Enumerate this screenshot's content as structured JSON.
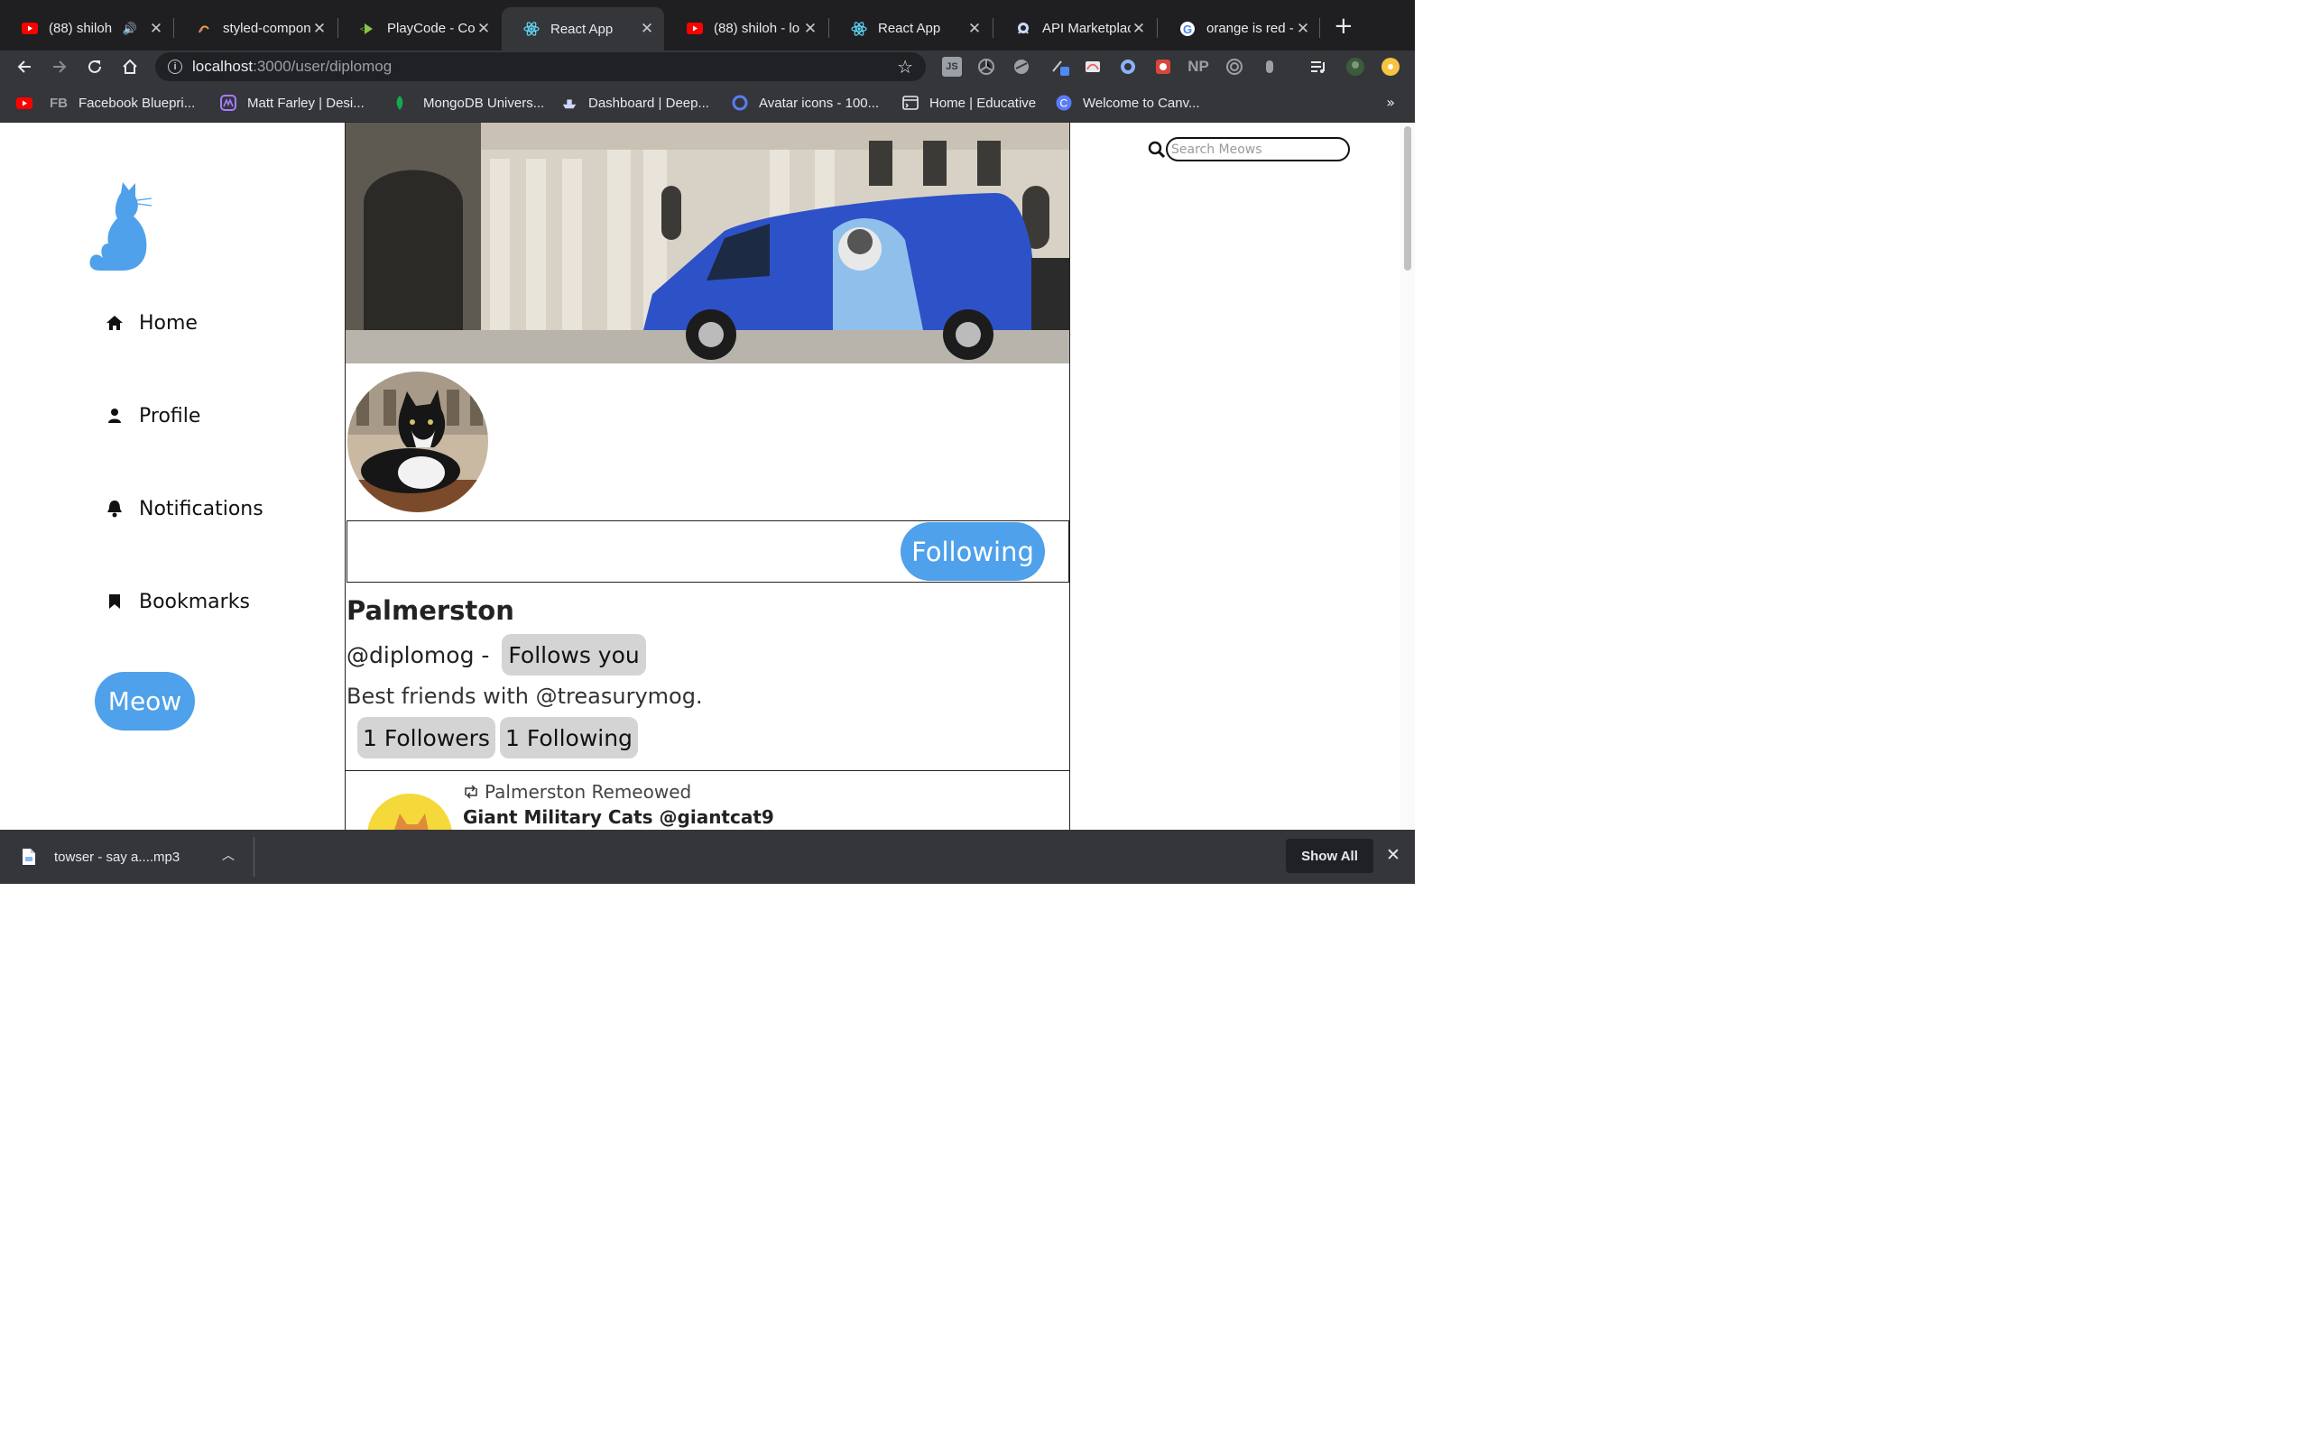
{
  "browser": {
    "tabs": [
      {
        "title": "(88) shiloh",
        "icon": "youtube-icon",
        "muted": true
      },
      {
        "title": "styled-compon",
        "icon": "styled-components-icon"
      },
      {
        "title": "PlayCode - Co",
        "icon": "playcode-icon"
      },
      {
        "title": "React App",
        "icon": "react-icon",
        "active": true
      },
      {
        "title": "(88) shiloh - lo",
        "icon": "youtube-icon"
      },
      {
        "title": "React App",
        "icon": "react-icon"
      },
      {
        "title": "API Marketplac",
        "icon": "rapidapi-icon"
      },
      {
        "title": "orange is red -",
        "icon": "google-icon"
      }
    ],
    "address": {
      "host": "localhost",
      "path": ":3000/user/diplomog"
    },
    "bookmarks": [
      {
        "label": "",
        "icon": "youtube-icon"
      },
      {
        "label": "Facebook Bluepri...",
        "prefix": "FB",
        "icon": "fb-icon"
      },
      {
        "label": "Matt Farley | Desi...",
        "icon": "matt-farley-icon"
      },
      {
        "label": "MongoDB Univers...",
        "icon": "mongodb-leaf-icon"
      },
      {
        "label": "Dashboard | Deep...",
        "icon": "deepnote-icon"
      },
      {
        "label": "Avatar icons - 100...",
        "icon": "avatar-icons-icon"
      },
      {
        "label": "Home | Educative",
        "icon": "educative-icon"
      },
      {
        "label": "Welcome to Canv...",
        "icon": "canvas-icon"
      }
    ],
    "extensions": {
      "js": "JS",
      "np": "NP"
    }
  },
  "app": {
    "nav": [
      {
        "label": "Home",
        "icon": "home-icon"
      },
      {
        "label": "Profile",
        "icon": "user-icon"
      },
      {
        "label": "Notifications",
        "icon": "bell-icon"
      },
      {
        "label": "Bookmarks",
        "icon": "bookmark-icon"
      }
    ],
    "meow_button": "Meow",
    "search_placeholder": "Search Meows",
    "profile": {
      "following_button": "Following",
      "name": "Palmerston",
      "handle": "@diplomog -",
      "follows_you": "Follows you",
      "bio": "Best friends with @treasurymog.",
      "followers": "1 Followers",
      "following": "1 Following"
    },
    "post": {
      "remeow_text": "Palmerston Remeowed",
      "author": "Giant Military Cats @giantcat9"
    }
  },
  "downloads": {
    "file": "towser - say a....mp3",
    "show_all": "Show All"
  },
  "colors": {
    "accent": "#4ea1ea",
    "chip": "#d4d4d4",
    "chrome_dark": "#35363a"
  }
}
